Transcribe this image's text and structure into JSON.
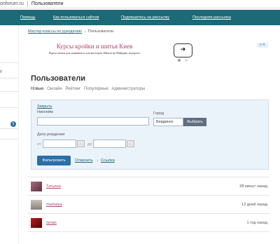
{
  "browser": {
    "url": "onforum.ru",
    "tab_title": "Пользователи"
  },
  "nav": {
    "items": [
      "Помощь",
      "Как пользоваться сайтом",
      "Подпишитесь на рассылку",
      "Последняя рассылка"
    ],
    "color": "#1c6977"
  },
  "sidebar": {
    "item1": "у",
    "badge": "5"
  },
  "breadcrumb": {
    "parent": "Мастер-классы по рукоделию",
    "arrow": "→",
    "current": "Пользователи"
  },
  "ad": {
    "title": "Курсы кройки и шитья Киев",
    "subtitle": "Курсы шитья для новичков и для мастеров. Школа на Майдане, недорого",
    "arrow_icon": "arrow-right-icon",
    "close_label": "▷✕"
  },
  "page": {
    "title": "Пользователи"
  },
  "tabs": [
    "Новые",
    "Онлайн",
    "Рейтинг",
    "Популярные",
    "Администраторы"
  ],
  "filter": {
    "close_label": "Закрыть",
    "nickname_label": "Никнейм",
    "nickname_value": "",
    "city_label": "Город",
    "city_value": "Бердянск",
    "choose_label": "Выбрать",
    "birth_label": "Дата рождения",
    "from_label": "от",
    "to_label": "до",
    "submit_label": "Фильтровать",
    "cancel_label": "Отменить",
    "link_label": "Ссылка"
  },
  "users": [
    {
      "name": "Татьяна",
      "time": "28 минут назад"
    },
    {
      "name": "mamalya",
      "time": "12 дней назад"
    },
    {
      "name": "tanais",
      "time": "1 год назад"
    }
  ]
}
